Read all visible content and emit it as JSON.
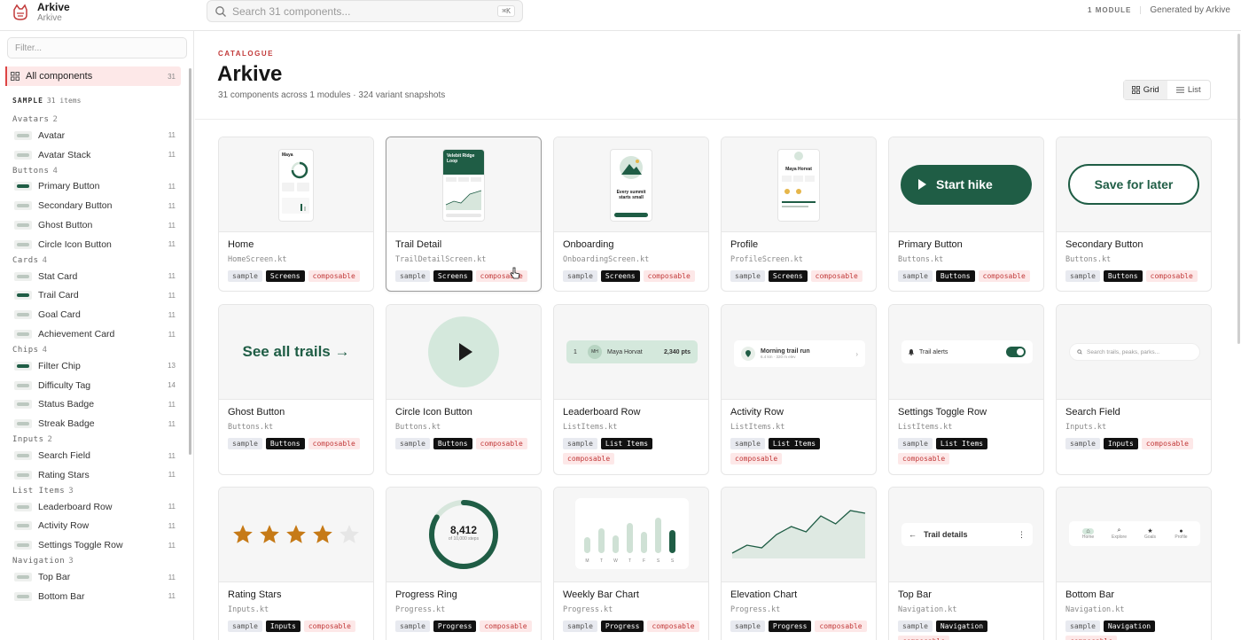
{
  "app": {
    "name": "Arkive",
    "subtitle": "Arkive"
  },
  "search": {
    "placeholder": "Search 31 components...",
    "shortcut": "⌘K"
  },
  "top_right": {
    "modules": "1 MODULE",
    "generated": "Generated by Arkive"
  },
  "sidebar": {
    "filter_placeholder": "Filter...",
    "all_label": "All components",
    "all_count": "31",
    "section": "SAMPLE",
    "section_count": "31 items",
    "groups": [
      {
        "name": "Avatars",
        "count": "2",
        "items": [
          {
            "label": "Avatar",
            "count": "11"
          },
          {
            "label": "Avatar Stack",
            "count": "11"
          }
        ]
      },
      {
        "name": "Buttons",
        "count": "4",
        "items": [
          {
            "label": "Primary Button",
            "count": "11"
          },
          {
            "label": "Secondary Button",
            "count": "11"
          },
          {
            "label": "Ghost Button",
            "count": "11"
          },
          {
            "label": "Circle Icon Button",
            "count": "11"
          }
        ]
      },
      {
        "name": "Cards",
        "count": "4",
        "items": [
          {
            "label": "Stat Card",
            "count": "11"
          },
          {
            "label": "Trail Card",
            "count": "11"
          },
          {
            "label": "Goal Card",
            "count": "11"
          },
          {
            "label": "Achievement Card",
            "count": "11"
          }
        ]
      },
      {
        "name": "Chips",
        "count": "4",
        "items": [
          {
            "label": "Filter Chip",
            "count": "13"
          },
          {
            "label": "Difficulty Tag",
            "count": "14"
          },
          {
            "label": "Status Badge",
            "count": "11"
          },
          {
            "label": "Streak Badge",
            "count": "11"
          }
        ]
      },
      {
        "name": "Inputs",
        "count": "2",
        "items": [
          {
            "label": "Search Field",
            "count": "11"
          },
          {
            "label": "Rating Stars",
            "count": "11"
          }
        ]
      },
      {
        "name": "List Items",
        "count": "3",
        "items": [
          {
            "label": "Leaderboard Row",
            "count": "11"
          },
          {
            "label": "Activity Row",
            "count": "11"
          },
          {
            "label": "Settings Toggle Row",
            "count": "11"
          }
        ]
      },
      {
        "name": "Navigation",
        "count": "3",
        "items": [
          {
            "label": "Top Bar",
            "count": "11"
          },
          {
            "label": "Bottom Bar",
            "count": "11"
          }
        ]
      }
    ]
  },
  "main": {
    "eyebrow": "CATALOGUE",
    "title": "Arkive",
    "subtitle": "31 components across 1 modules · 324 variant snapshots",
    "view_grid": "Grid",
    "view_list": "List"
  },
  "cards": [
    {
      "title": "Home",
      "file": "HomeScreen.kt",
      "tags": [
        "sample",
        "Screens",
        "composable"
      ],
      "preview": "home"
    },
    {
      "title": "Trail Detail",
      "file": "TrailDetailScreen.kt",
      "tags": [
        "sample",
        "Screens",
        "composable"
      ],
      "preview": "trail"
    },
    {
      "title": "Onboarding",
      "file": "OnboardingScreen.kt",
      "tags": [
        "sample",
        "Screens",
        "composable"
      ],
      "preview": "onboarding"
    },
    {
      "title": "Profile",
      "file": "ProfileScreen.kt",
      "tags": [
        "sample",
        "Screens",
        "composable"
      ],
      "preview": "profile"
    },
    {
      "title": "Primary Button",
      "file": "Buttons.kt",
      "tags": [
        "sample",
        "Buttons",
        "composable"
      ],
      "preview": "primary"
    },
    {
      "title": "Secondary Button",
      "file": "Buttons.kt",
      "tags": [
        "sample",
        "Buttons",
        "composable"
      ],
      "preview": "secondary"
    },
    {
      "title": "Ghost Button",
      "file": "Buttons.kt",
      "tags": [
        "sample",
        "Buttons",
        "composable"
      ],
      "preview": "ghost"
    },
    {
      "title": "Circle Icon Button",
      "file": "Buttons.kt",
      "tags": [
        "sample",
        "Buttons",
        "composable"
      ],
      "preview": "circle"
    },
    {
      "title": "Leaderboard Row",
      "file": "ListItems.kt",
      "tags": [
        "sample",
        "List Items",
        "composable"
      ],
      "preview": "leaderboard"
    },
    {
      "title": "Activity Row",
      "file": "ListItems.kt",
      "tags": [
        "sample",
        "List Items",
        "composable"
      ],
      "preview": "activity"
    },
    {
      "title": "Settings Toggle Row",
      "file": "ListItems.kt",
      "tags": [
        "sample",
        "List Items",
        "composable"
      ],
      "preview": "toggle"
    },
    {
      "title": "Search Field",
      "file": "Inputs.kt",
      "tags": [
        "sample",
        "Inputs",
        "composable"
      ],
      "preview": "search"
    },
    {
      "title": "Rating Stars",
      "file": "Inputs.kt",
      "tags": [
        "sample",
        "Inputs",
        "composable"
      ],
      "preview": "stars"
    },
    {
      "title": "Progress Ring",
      "file": "Progress.kt",
      "tags": [
        "sample",
        "Progress",
        "composable"
      ],
      "preview": "ring"
    },
    {
      "title": "Weekly Bar Chart",
      "file": "Progress.kt",
      "tags": [
        "sample",
        "Progress",
        "composable"
      ],
      "preview": "bars"
    },
    {
      "title": "Elevation Chart",
      "file": "Progress.kt",
      "tags": [
        "sample",
        "Progress",
        "composable"
      ],
      "preview": "elevation"
    },
    {
      "title": "Top Bar",
      "file": "Navigation.kt",
      "tags": [
        "sample",
        "Navigation",
        "composable"
      ],
      "preview": "topbar"
    },
    {
      "title": "Bottom Bar",
      "file": "Navigation.kt",
      "tags": [
        "sample",
        "Navigation",
        "composable"
      ],
      "preview": "bottombar"
    }
  ],
  "previews": {
    "home": {
      "name": "Maya"
    },
    "trail": {
      "title": "Velebit Ridge Loop"
    },
    "onboarding": {
      "headline": "Every summit starts small"
    },
    "profile": {
      "name": "Maya Horvat"
    },
    "primary": {
      "label": "Start hike"
    },
    "secondary": {
      "label": "Save for later"
    },
    "ghost": {
      "label": "See all trails →"
    },
    "leaderboard": {
      "rank": "1",
      "initials": "MH",
      "name": "Maya Horvat",
      "points": "2,340 pts"
    },
    "activity": {
      "title": "Morning trail run",
      "meta": "6.4 km · 320 m elev"
    },
    "toggle": {
      "label": "Trail alerts"
    },
    "search": {
      "placeholder": "Search trails, peaks, parks..."
    },
    "stars": {
      "rating": 4,
      "max": 5
    },
    "ring": {
      "value": "8,412",
      "caption": "of 10,000 steps",
      "fraction": 0.84
    },
    "bars": {
      "days": [
        "M",
        "T",
        "W",
        "T",
        "F",
        "S",
        "S"
      ],
      "values": [
        0.45,
        0.7,
        0.5,
        0.85,
        0.6,
        1.0,
        0.65
      ]
    },
    "elevation": {
      "values": [
        0.1,
        0.25,
        0.2,
        0.45,
        0.6,
        0.5,
        0.8,
        0.65,
        0.9,
        0.85
      ]
    },
    "topbar": {
      "title": "Trail details"
    },
    "bottombar": {
      "tabs": [
        "Home",
        "Explore",
        "Goals",
        "Profile"
      ]
    }
  },
  "colors": {
    "brand": "#1f5d45",
    "accent": "#c23a3a",
    "star": "#c67a17"
  }
}
